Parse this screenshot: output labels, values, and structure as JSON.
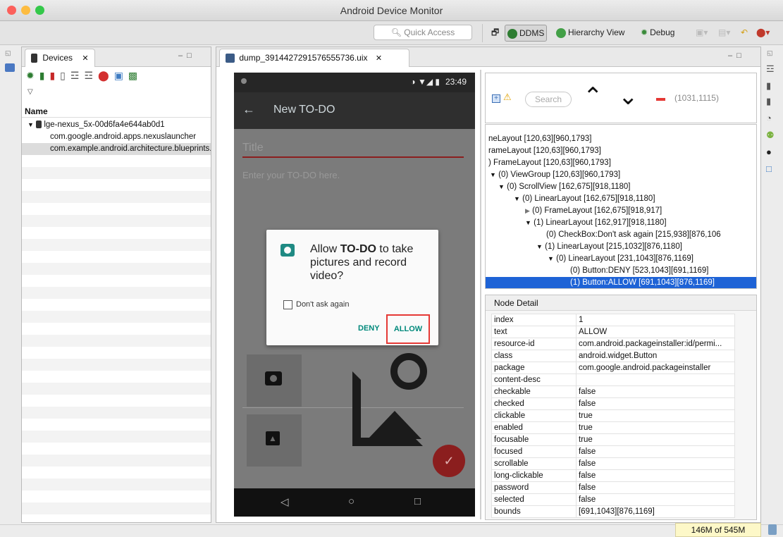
{
  "window": {
    "title": "Android Device Monitor"
  },
  "toolbar": {
    "quick_access_placeholder": "Quick Access",
    "perspectives": [
      {
        "label": "DDMS",
        "icon": "ddms-icon"
      },
      {
        "label": "Hierarchy View",
        "icon": "hierarchy-view-icon"
      },
      {
        "label": "Debug",
        "icon": "debug-icon"
      }
    ]
  },
  "devices_view": {
    "tab_label": "Devices",
    "column_header": "Name",
    "device": "lge-nexus_5x-00d6fa4e644ab0d1",
    "processes": [
      "com.google.android.apps.nexuslauncher",
      "com.example.android.architecture.blueprints.todomvp"
    ]
  },
  "dump_view": {
    "tab_label": "dump_3914427291576555736.uix"
  },
  "phone": {
    "status_time": "23:49",
    "app_title": "New TO-DO",
    "title_hint": "Title",
    "description_hint": "Enter your TO-DO here.",
    "dialog": {
      "message_prefix": "Allow ",
      "app_name": "TO-DO",
      "message_suffix": " to take pictures and record video?",
      "checkbox_label": "Don't ask again",
      "deny_label": "DENY",
      "allow_label": "ALLOW"
    }
  },
  "hierarchy": {
    "search_placeholder": "Search",
    "coords": "(1031,1115)",
    "tree": [
      {
        "text": "neLayout [120,63][960,1793]",
        "expander": ""
      },
      {
        "text": "rameLayout [120,63][960,1793]",
        "expander": ""
      },
      {
        "text": ") FrameLayout [120,63][960,1793]",
        "expander": ""
      },
      {
        "text": "(0) ViewGroup [120,63][960,1793]",
        "expander": "▼"
      },
      {
        "text": "(0) ScrollView [162,675][918,1180]",
        "expander": "▼"
      },
      {
        "text": "(0) LinearLayout [162,675][918,1180]",
        "expander": "▼"
      },
      {
        "text": "(0) FrameLayout [162,675][918,917]",
        "expander": "▶"
      },
      {
        "text": "(1) LinearLayout [162,917][918,1180]",
        "expander": "▼"
      },
      {
        "text": "(0) CheckBox:Don't ask again [215,938][876,106",
        "expander": ""
      },
      {
        "text": "(1) LinearLayout [215,1032][876,1180]",
        "expander": "▼"
      },
      {
        "text": "(0) LinearLayout [231,1043][876,1169]",
        "expander": "▼"
      },
      {
        "text": "(0) Button:DENY [523,1043][691,1169]",
        "expander": ""
      },
      {
        "text": "(1) Button:ALLOW [691,1043][876,1169]",
        "expander": ""
      }
    ]
  },
  "node_detail": {
    "title": "Node Detail",
    "rows": [
      {
        "key": "index",
        "value": "1"
      },
      {
        "key": "text",
        "value": "ALLOW"
      },
      {
        "key": "resource-id",
        "value": "com.android.packageinstaller:id/permi..."
      },
      {
        "key": "class",
        "value": "android.widget.Button"
      },
      {
        "key": "package",
        "value": "com.google.android.packageinstaller"
      },
      {
        "key": "content-desc",
        "value": ""
      },
      {
        "key": "checkable",
        "value": "false"
      },
      {
        "key": "checked",
        "value": "false"
      },
      {
        "key": "clickable",
        "value": "true"
      },
      {
        "key": "enabled",
        "value": "true"
      },
      {
        "key": "focusable",
        "value": "true"
      },
      {
        "key": "focused",
        "value": "false"
      },
      {
        "key": "scrollable",
        "value": "false"
      },
      {
        "key": "long-clickable",
        "value": "false"
      },
      {
        "key": "password",
        "value": "false"
      },
      {
        "key": "selected",
        "value": "false"
      },
      {
        "key": "bounds",
        "value": "[691,1043][876,1169]"
      }
    ]
  },
  "status": {
    "memory": "146M of 545M"
  },
  "colors": {
    "selection": "#1e63d6",
    "highlight_box": "#e53935",
    "fab": "#8b1e1e",
    "dialog_accent": "#009688"
  }
}
